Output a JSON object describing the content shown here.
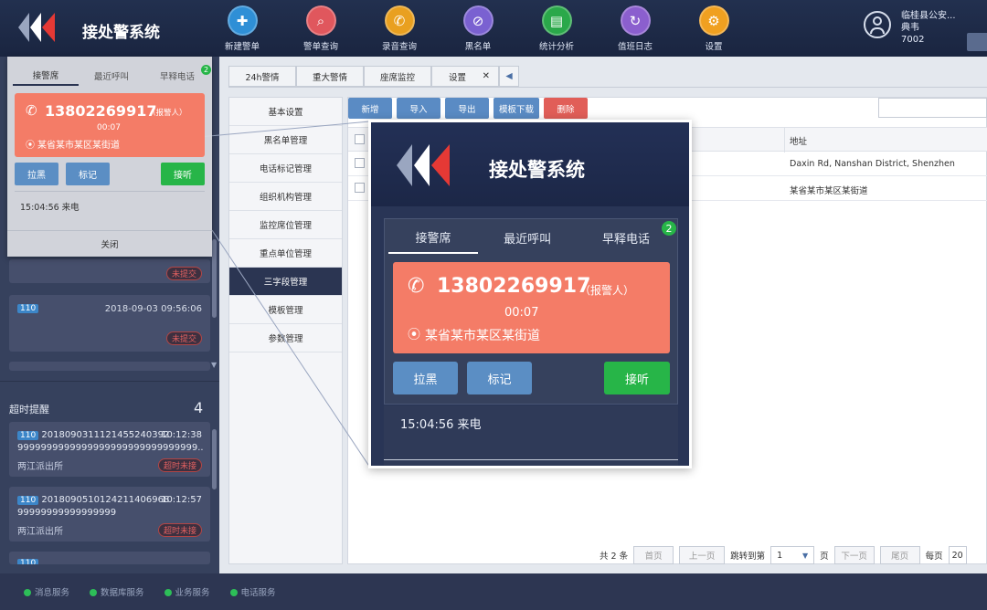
{
  "header": {
    "app_title": "接处警系统",
    "nav": [
      {
        "label": "新建警单",
        "icon": "document-add-icon",
        "color": "#2f8fd6",
        "glyph": "✚"
      },
      {
        "label": "警单查询",
        "icon": "document-search-icon",
        "color": "#e0575d",
        "glyph": "⌕"
      },
      {
        "label": "录音查询",
        "icon": "phone-record-icon",
        "color": "#e9a020",
        "glyph": "✆"
      },
      {
        "label": "黑名单",
        "icon": "user-block-icon",
        "color": "#7a61d1",
        "glyph": "⊘"
      },
      {
        "label": "统计分析",
        "icon": "chart-icon",
        "color": "#2aa84a",
        "glyph": "▤"
      },
      {
        "label": "值班日志",
        "icon": "user-refresh-icon",
        "color": "#8b5fce",
        "glyph": "↻"
      },
      {
        "label": "设置",
        "icon": "gear-icon",
        "color": "#f0a020",
        "glyph": "⚙"
      }
    ],
    "user": {
      "org": "临桂县公安...",
      "name": "典韦",
      "id": "7002"
    }
  },
  "small_dialog": {
    "tabs": [
      "接警席",
      "最近呼叫",
      "早释电话"
    ],
    "tab_badge": "2",
    "phone": "13802269917",
    "role": "（报警人）",
    "timer": "00:07",
    "address": "某省某市某区某街道",
    "btn_block": "拉黑",
    "btn_mark": "标记",
    "btn_answer": "接听",
    "log": "15:04:56 来电",
    "close": "关闭"
  },
  "left_panel": {
    "status_submitted": "未提交",
    "cards": [
      {
        "badge": "110",
        "time": "2018-09-03 09:56:06",
        "status": "未提交"
      }
    ],
    "overdue_title": "超时提醒",
    "overdue_count": "4",
    "overdue": [
      {
        "badge": "110",
        "id": "2018090311121455240392",
        "time": "10:12:38",
        "line2": "9999999999999999999999999999999...",
        "station": "两江派出所",
        "status": "超时未接"
      },
      {
        "badge": "110",
        "id": "2018090510124211406968",
        "time": "10:12:57",
        "line2": "99999999999999999",
        "station": "两江派出所",
        "status": "超时未接"
      }
    ],
    "peek_badge": "110"
  },
  "main": {
    "tabs": [
      "24h警情",
      "重大警情",
      "座席监控",
      "设置"
    ],
    "menu": [
      "基本设置",
      "黑名单管理",
      "电话标记管理",
      "组织机构管理",
      "监控席位管理",
      "重点单位管理",
      "三字段管理",
      "模板管理",
      "参数管理"
    ],
    "active_menu": 6,
    "toolbar": [
      "新增",
      "导入",
      "导出",
      "模板下载",
      "删除"
    ],
    "table_header_address": "地址",
    "rows": [
      {
        "address": "Daxin Rd, Nanshan District, Shenzhen"
      },
      {
        "address": "某省某市某区某街道"
      }
    ],
    "pager": {
      "total": "共 2 条",
      "first": "首页",
      "prev": "上一页",
      "jump": "跳转到第",
      "page": "1",
      "page_unit": "页",
      "next": "下一页",
      "last": "尾页",
      "per_page": "每页",
      "per_page_value": "20"
    }
  },
  "zoom": {
    "app_title": "接处警系统",
    "tabs": [
      "接警席",
      "最近呼叫",
      "早释电话"
    ],
    "tab_badge": "2",
    "phone": "13802269917",
    "role": "（报警人）",
    "timer": "00:07",
    "address": "某省某市某区某街道",
    "btn_block": "拉黑",
    "btn_mark": "标记",
    "btn_answer": "接听",
    "log": "15:04:56 来电"
  },
  "footer": [
    "消息服务",
    "数据库服务",
    "业务服务",
    "电话服务"
  ],
  "colors": {
    "accent": "#2b3552",
    "phone_card": "#f47c67",
    "answer": "#27b548",
    "action": "#5b8ec4"
  }
}
